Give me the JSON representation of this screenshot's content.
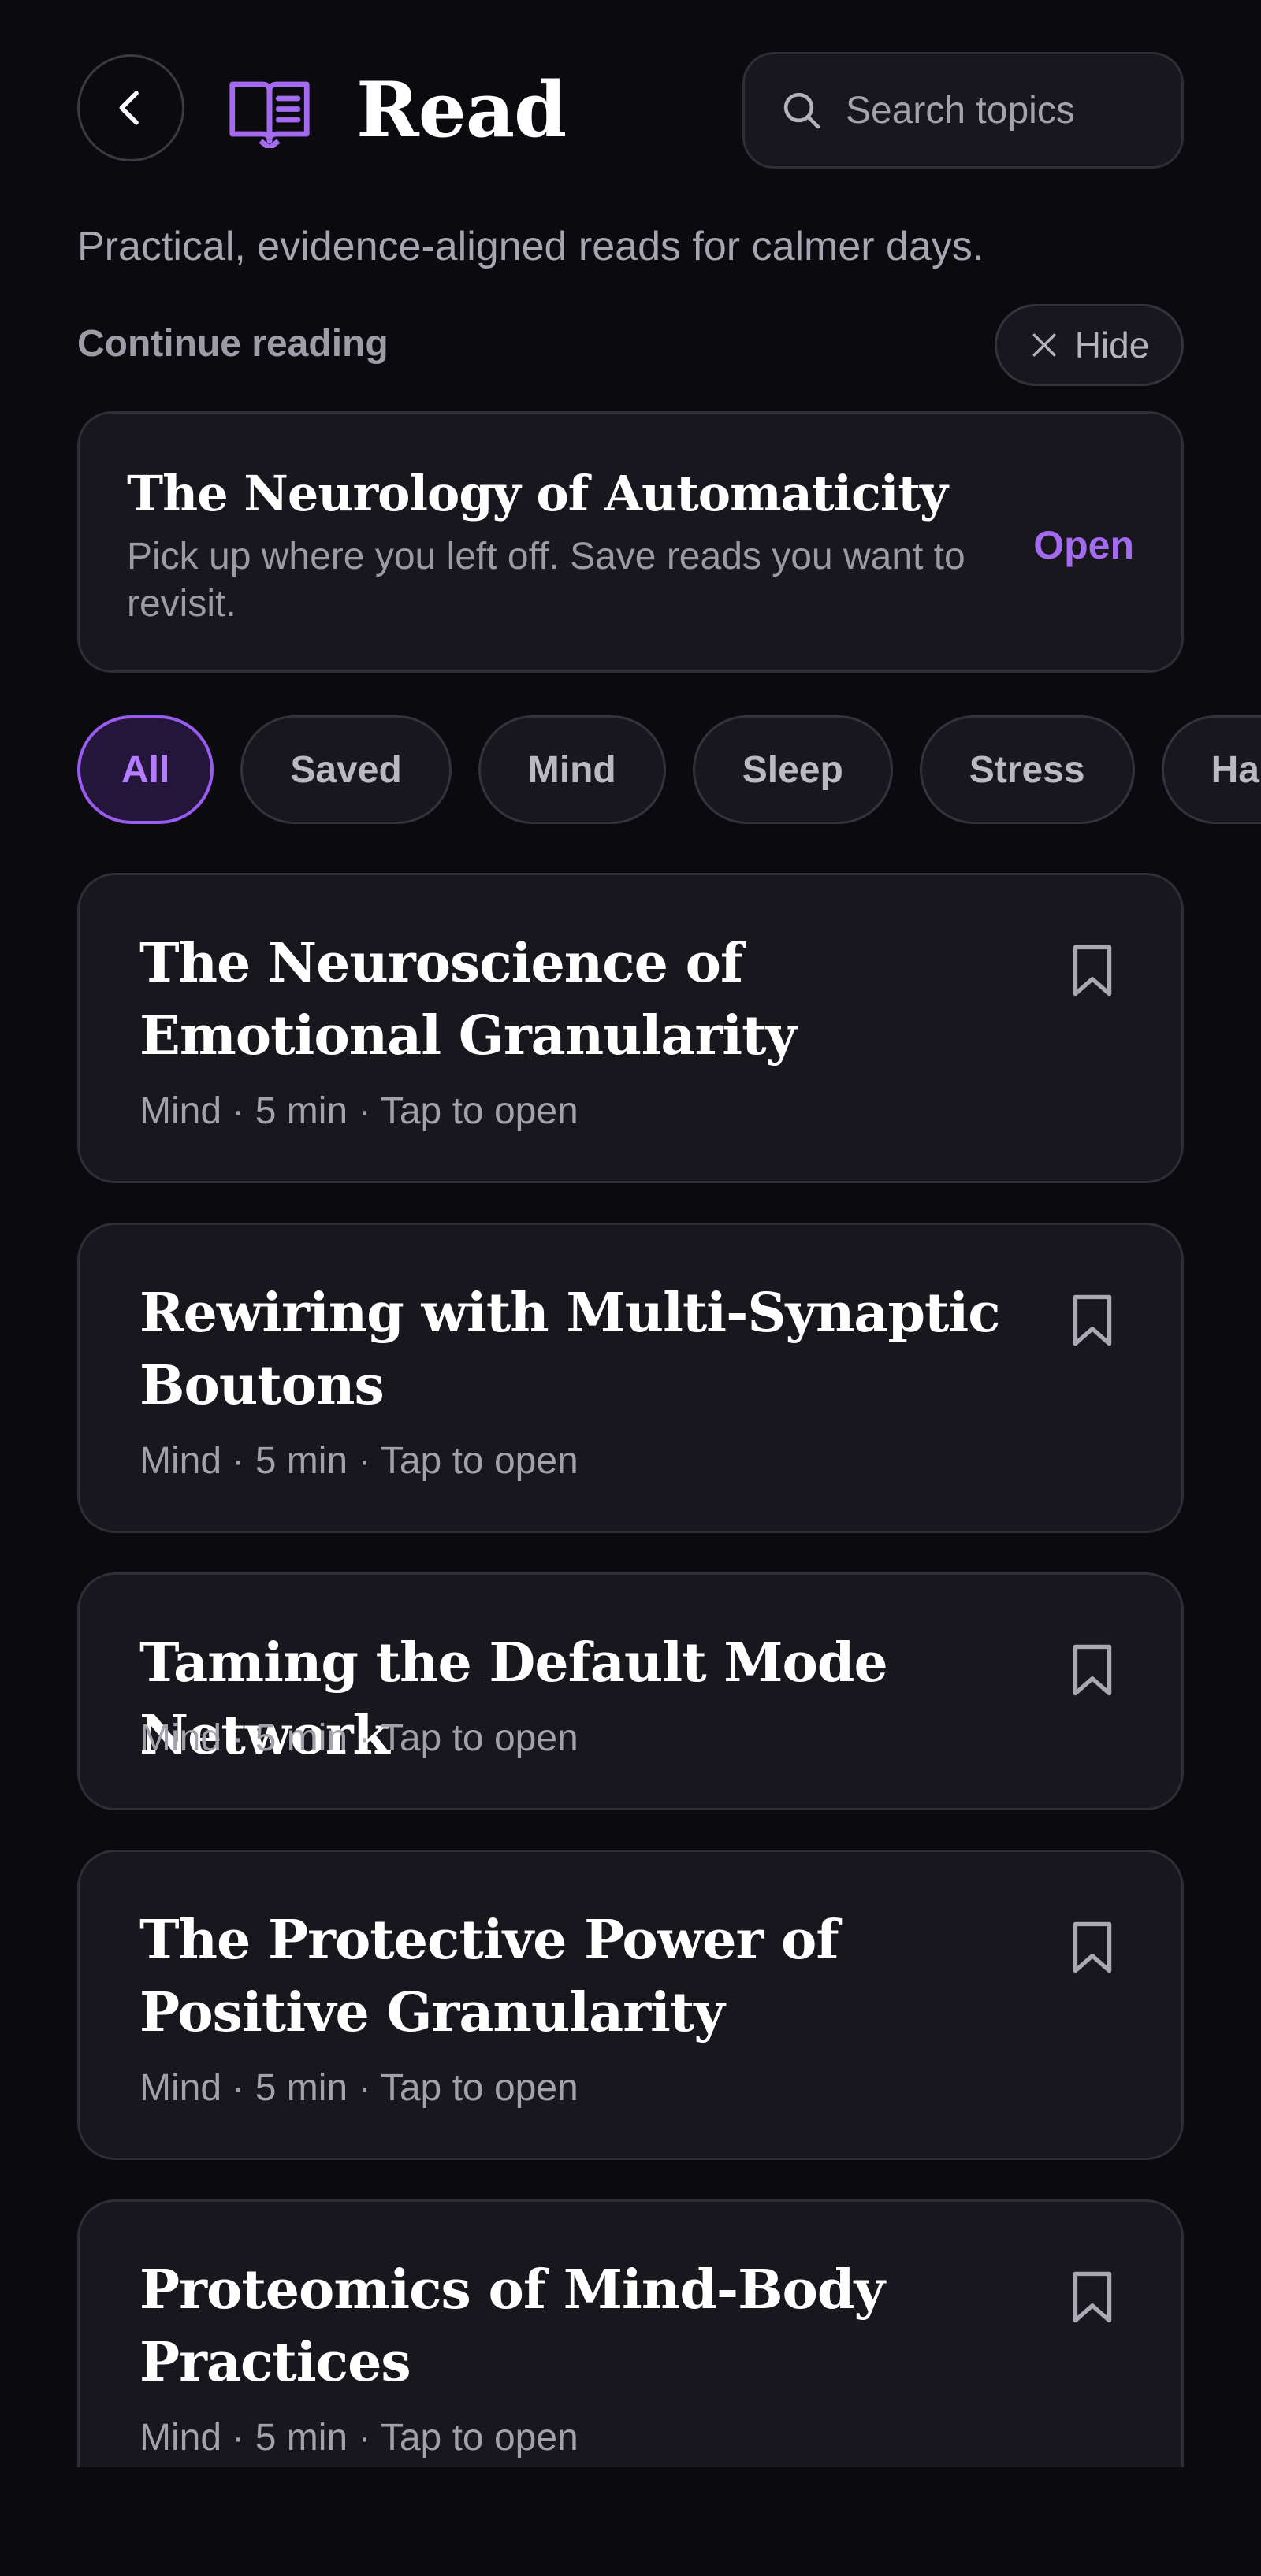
{
  "header": {
    "title": "Read",
    "search_placeholder": "Search topics"
  },
  "subtitle": "Practical, evidence-aligned reads for calmer days.",
  "continue_reading": {
    "label": "Continue reading",
    "hide_label": "Hide",
    "card": {
      "title": "The Neurology of Automaticity",
      "description": "Pick up where you left off. Save reads you want to revisit.",
      "open_label": "Open"
    }
  },
  "filters": {
    "chips": [
      "All",
      "Saved",
      "Mind",
      "Sleep",
      "Stress",
      "Habits"
    ],
    "selected": "All"
  },
  "articles": [
    {
      "title": "The Neuroscience of Emotional Granularity",
      "meta": "Mind · 5 min · Tap to open"
    },
    {
      "title": "Rewiring with Multi-Synaptic Boutons",
      "meta": "Mind · 5 min · Tap to open"
    },
    {
      "title": "Taming the Default Mode Network",
      "meta": "Mind · 5 min · Tap to open"
    },
    {
      "title": "The Protective Power of Positive Granularity",
      "meta": "Mind · 5 min · Tap to open"
    },
    {
      "title": "Proteomics of Mind-Body Practices",
      "meta": "Mind · 5 min · Tap to open"
    }
  ],
  "colors": {
    "background": "#0b0b0f",
    "card": "#17171d",
    "accent": "#a46bf0",
    "accent_bg": "#24163a"
  },
  "icons": {
    "back": "chevron-left-icon",
    "book": "book-open-icon",
    "search": "search-icon",
    "close": "close-icon",
    "bookmark": "bookmark-icon"
  }
}
